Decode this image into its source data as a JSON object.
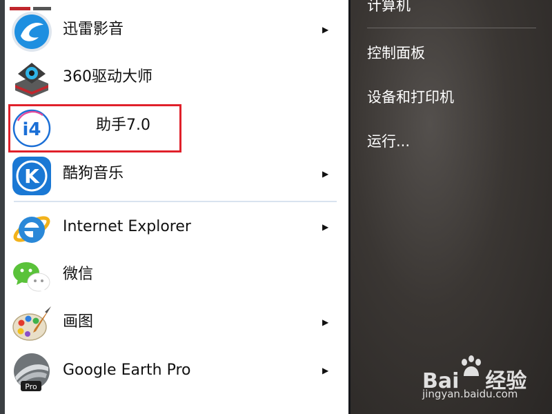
{
  "start_menu": {
    "programs": [
      {
        "label": "迅雷影音",
        "icon": "xunlei-player-icon",
        "has_submenu": true
      },
      {
        "label": "360驱动大师",
        "icon": "360-driver-master-icon",
        "has_submenu": false
      },
      {
        "label": "助手7.0",
        "icon": "i4-assistant-icon",
        "has_submenu": false
      },
      {
        "label": "酷狗音乐",
        "icon": "kugou-music-icon",
        "has_submenu": true
      },
      {
        "label": "Internet Explorer",
        "icon": "internet-explorer-icon",
        "has_submenu": true
      },
      {
        "label": "微信",
        "icon": "wechat-icon",
        "has_submenu": false
      },
      {
        "label": "画图",
        "icon": "paint-icon",
        "has_submenu": true
      },
      {
        "label": "Google Earth Pro",
        "icon": "google-earth-pro-icon",
        "has_submenu": true
      }
    ],
    "submenu_arrow": "▶",
    "icon_texts": {
      "i4": "i4",
      "kugou": "K",
      "ge_pro": "Pro"
    },
    "right_items": [
      "计算机",
      "控制面板",
      "设备和打印机",
      "运行..."
    ]
  },
  "watermark": {
    "brand": "Bai",
    "brand_suffix": "经验",
    "url": "jingyan.baidu.com"
  },
  "colors": {
    "highlight_border": "#e0202a",
    "xunlei_blue": "#1e8fe0",
    "kugou_blue": "#1a78d4",
    "i4_blue": "#1b6fd6",
    "wechat_green": "#5ac23a",
    "ie_blue": "#2a88d8"
  }
}
